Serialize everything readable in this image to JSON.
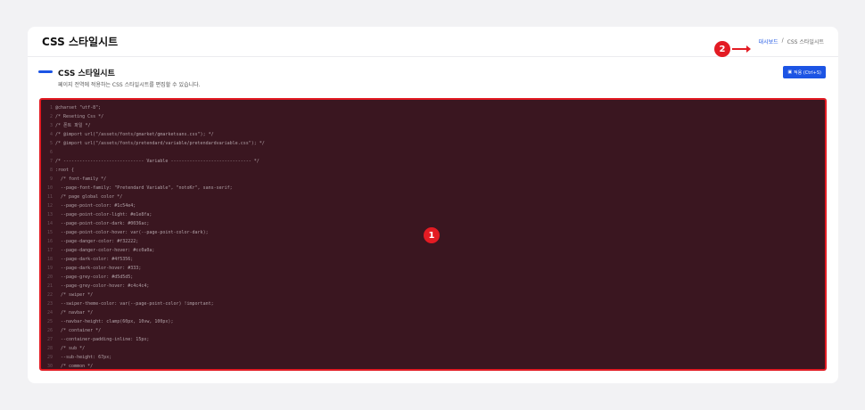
{
  "header": {
    "title": "CSS 스타일시트",
    "breadcrumb": [
      "대시보드",
      "/",
      "CSS 스타일시트"
    ]
  },
  "section": {
    "title": "CSS 스타일시트",
    "description": "페이지 전역에 적용하는 CSS 스타일시트를 편집할 수 있습니다.",
    "apply_label": "적용 (Ctrl+S)"
  },
  "annotations": [
    "1",
    "2"
  ],
  "editor": {
    "lines": [
      "@charset \"utf-8\";",
      "/* Reseting Css */",
      "/* 폰트 파일 */",
      "/* @import url(\"/assets/fonts/gmarket/gmarketsans.css\"); */",
      "/* @import url(\"/assets/fonts/pretendard/variable/pretendardvariable.css\"); */",
      "",
      "/* ------------------------------ Variable ------------------------------ */",
      ":root {",
      "  /* font-family */",
      "  --page-font-family: \"Pretendard Variable\", \"notoKr\", sans-serif;",
      "  /* page global color */",
      "  --page-point-color: #1c54e4;",
      "  --page-point-color-light: #e1e8fa;",
      "  --page-point-color-dark: #0036ac;",
      "  --page-point-color-hover: var(--page-point-color-dark);",
      "  --page-danger-color: #f32222;",
      "  --page-danger-color-hover: #cc0a0a;",
      "  --page-dark-color: #4f5356;",
      "  --page-dark-color-hover: #333;",
      "  --page-grey-color: #d5d5d5;",
      "  --page-grey-color-hover: #c4c4c4;",
      "  /* swiper */",
      "  --swiper-theme-color: var(--page-point-color) !important;",
      "  /* navbar */",
      "  --navbar-height: clamp(60px, 10vw, 100px);",
      "  /* container */",
      "  --container-padding-inline: 15px;",
      "  /* sub */",
      "  --sub-height: 67px;",
      "  /* common */"
    ]
  }
}
